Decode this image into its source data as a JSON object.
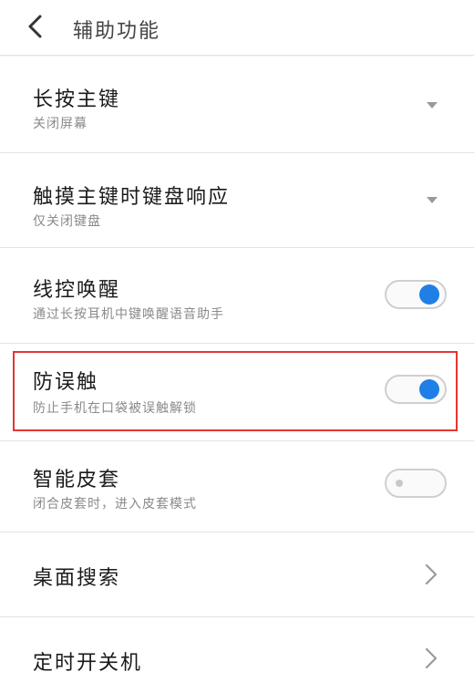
{
  "header": {
    "title": "辅助功能"
  },
  "items": [
    {
      "title": "长按主键",
      "subtitle": "关闭屏幕",
      "control": "dropdown"
    },
    {
      "title": "触摸主键时键盘响应",
      "subtitle": "仅关闭键盘",
      "control": "dropdown"
    },
    {
      "title": "线控唤醒",
      "subtitle": "通过长按耳机中键唤醒语音助手",
      "control": "toggle",
      "state": "on"
    },
    {
      "title": "防误触",
      "subtitle": "防止手机在口袋被误触解锁",
      "control": "toggle",
      "state": "on"
    },
    {
      "title": "智能皮套",
      "subtitle": "闭合皮套时，进入皮套模式",
      "control": "toggle",
      "state": "off"
    },
    {
      "title": "桌面搜索",
      "control": "chevron"
    },
    {
      "title": "定时开关机",
      "control": "chevron"
    }
  ],
  "colors": {
    "accent": "#1f7fe6",
    "highlight": "#e53535"
  }
}
